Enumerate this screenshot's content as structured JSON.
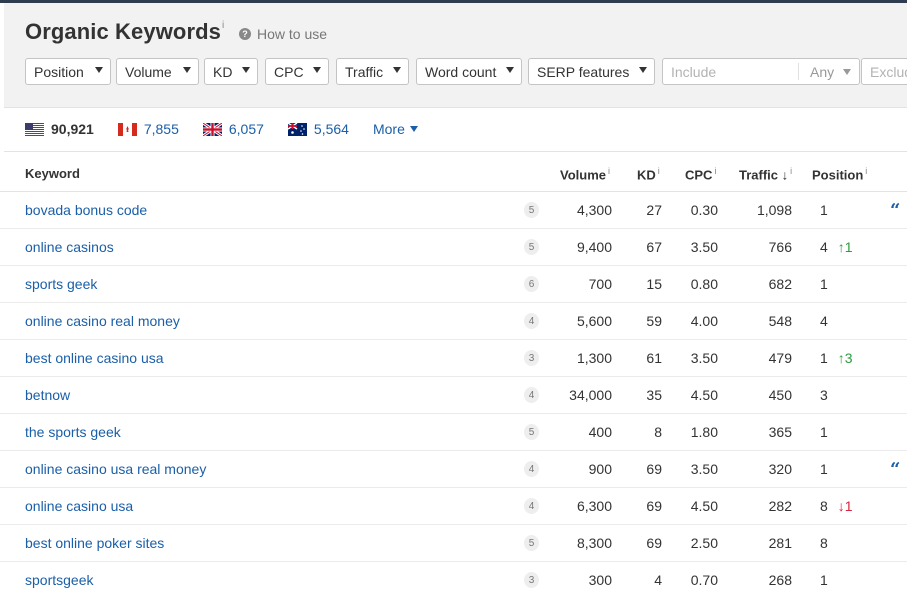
{
  "header": {
    "title": "Organic Keywords",
    "title_info": "i",
    "how_to_use": "How to use"
  },
  "filters": [
    {
      "label": "Position"
    },
    {
      "label": "Volume"
    },
    {
      "label": "KD"
    },
    {
      "label": "CPC"
    },
    {
      "label": "Traffic"
    },
    {
      "label": "Word count"
    },
    {
      "label": "SERP features"
    }
  ],
  "include": {
    "placeholder": "Include",
    "mode": "Any"
  },
  "exclude": {
    "placeholder": "Exclude"
  },
  "countries": [
    {
      "flag": "us-flag-icon",
      "value": "90,921",
      "active": true
    },
    {
      "flag": "ca-flag-icon",
      "value": "7,855",
      "active": false
    },
    {
      "flag": "gb-flag-icon",
      "value": "6,057",
      "active": false
    },
    {
      "flag": "au-flag-icon",
      "value": "5,564",
      "active": false
    }
  ],
  "more_label": "More",
  "table": {
    "headers": {
      "keyword": "Keyword",
      "volume": "Volume",
      "kd": "KD",
      "cpc": "CPC",
      "traffic": "Traffic",
      "position": "Position",
      "info": "i",
      "sort_arrow": "↓"
    },
    "rows": [
      {
        "keyword": "bovada bonus code",
        "words": "5",
        "volume": "4,300",
        "kd": "27",
        "cpc": "0.30",
        "traffic": "1,098",
        "position": "1",
        "change": "",
        "change_dir": "",
        "serp": true
      },
      {
        "keyword": "online casinos",
        "words": "5",
        "volume": "9,400",
        "kd": "67",
        "cpc": "3.50",
        "traffic": "766",
        "position": "4",
        "change": "↑1",
        "change_dir": "up",
        "serp": false
      },
      {
        "keyword": "sports geek",
        "words": "6",
        "volume": "700",
        "kd": "15",
        "cpc": "0.80",
        "traffic": "682",
        "position": "1",
        "change": "",
        "change_dir": "",
        "serp": false
      },
      {
        "keyword": "online casino real money",
        "words": "4",
        "volume": "5,600",
        "kd": "59",
        "cpc": "4.00",
        "traffic": "548",
        "position": "4",
        "change": "",
        "change_dir": "",
        "serp": false
      },
      {
        "keyword": "best online casino usa",
        "words": "3",
        "volume": "1,300",
        "kd": "61",
        "cpc": "3.50",
        "traffic": "479",
        "position": "1",
        "change": "↑3",
        "change_dir": "up",
        "serp": false
      },
      {
        "keyword": "betnow",
        "words": "4",
        "volume": "34,000",
        "kd": "35",
        "cpc": "4.50",
        "traffic": "450",
        "position": "3",
        "change": "",
        "change_dir": "",
        "serp": false
      },
      {
        "keyword": "the sports geek",
        "words": "5",
        "volume": "400",
        "kd": "8",
        "cpc": "1.80",
        "traffic": "365",
        "position": "1",
        "change": "",
        "change_dir": "",
        "serp": false
      },
      {
        "keyword": "online casino usa real money",
        "words": "4",
        "volume": "900",
        "kd": "69",
        "cpc": "3.50",
        "traffic": "320",
        "position": "1",
        "change": "",
        "change_dir": "",
        "serp": true
      },
      {
        "keyword": "online casino usa",
        "words": "4",
        "volume": "6,300",
        "kd": "69",
        "cpc": "4.50",
        "traffic": "282",
        "position": "8",
        "change": "↓1",
        "change_dir": "down",
        "serp": false
      },
      {
        "keyword": "best online poker sites",
        "words": "5",
        "volume": "8,300",
        "kd": "69",
        "cpc": "2.50",
        "traffic": "281",
        "position": "8",
        "change": "",
        "change_dir": "",
        "serp": false
      },
      {
        "keyword": "sportsgeek",
        "words": "3",
        "volume": "300",
        "kd": "4",
        "cpc": "0.70",
        "traffic": "268",
        "position": "1",
        "change": "",
        "change_dir": "",
        "serp": false
      }
    ]
  },
  "colors": {
    "link": "#1a5fa8",
    "up": "#2a9d3e",
    "down": "#d7263d"
  }
}
